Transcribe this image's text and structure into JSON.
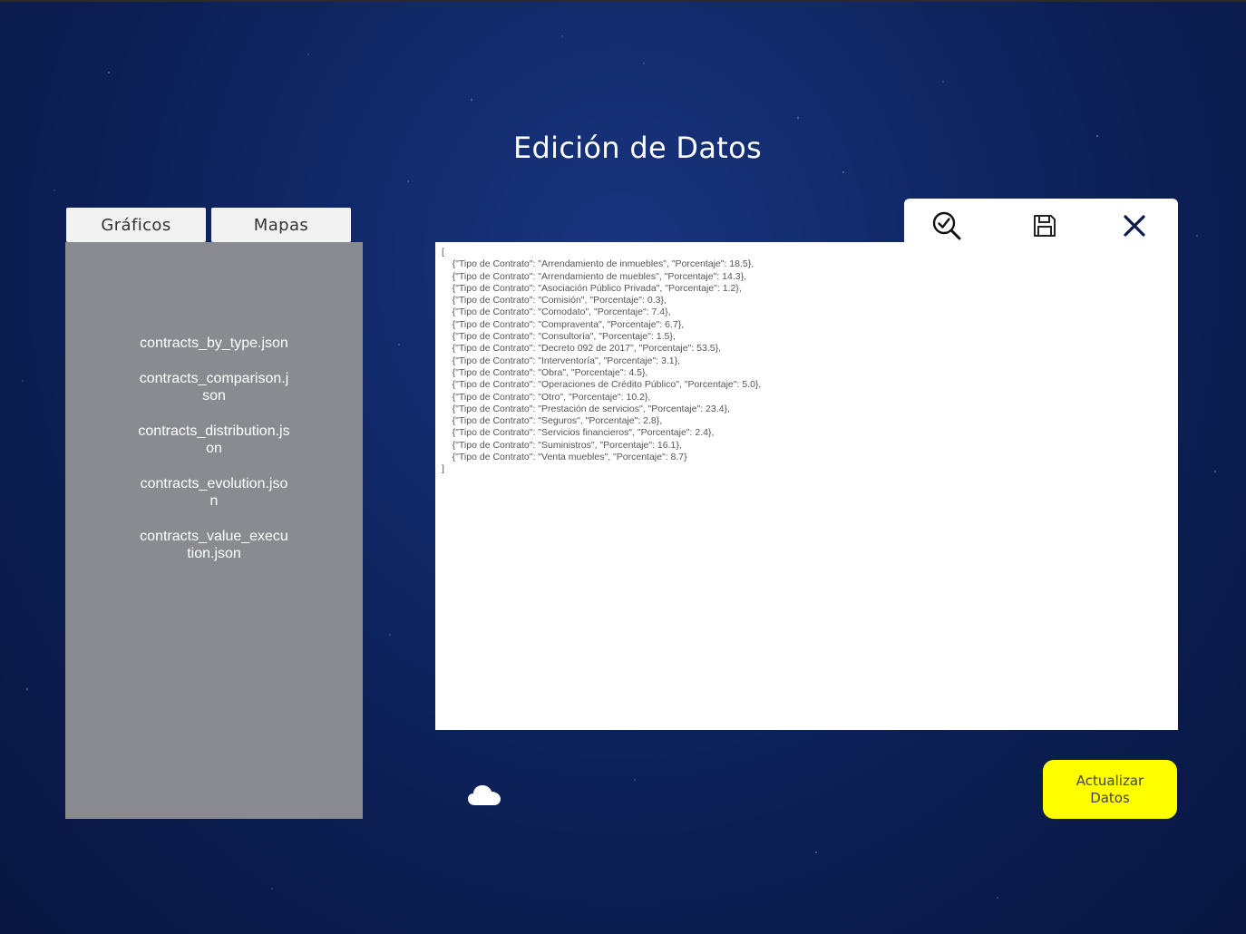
{
  "page": {
    "title": "Edición de Datos"
  },
  "tabs": [
    {
      "label": "Gráficos"
    },
    {
      "label": "Mapas"
    }
  ],
  "files": [
    "contracts_by_type.json",
    "contracts_comparison.json",
    "contracts_distribution.json",
    "contracts_evolution.json",
    "contracts_value_execution.json"
  ],
  "toolbar": {
    "validate_icon": "magnifier-check-icon",
    "save_icon": "floppy-disk-icon",
    "close_icon": "close-icon"
  },
  "editor": {
    "content": "[\n    {\"Tipo de Contrato\": \"Arrendamiento de inmuebles\", \"Porcentaje\": 18.5},\n    {\"Tipo de Contrato\": \"Arrendamiento de muebles\", \"Porcentaje\": 14.3},\n    {\"Tipo de Contrato\": \"Asociación Público Privada\", \"Porcentaje\": 1.2},\n    {\"Tipo de Contrato\": \"Comisión\", \"Porcentaje\": 0.3},\n    {\"Tipo de Contrato\": \"Comodato\", \"Porcentaje\": 7.4},\n    {\"Tipo de Contrato\": \"Compraventa\", \"Porcentaje\": 6.7},\n    {\"Tipo de Contrato\": \"Consultoría\", \"Porcentaje\": 1.5},\n    {\"Tipo de Contrato\": \"Decreto 092 de 2017\", \"Porcentaje\": 53.5},\n    {\"Tipo de Contrato\": \"Interventoría\", \"Porcentaje\": 3.1},\n    {\"Tipo de Contrato\": \"Obra\", \"Porcentaje\": 4.5},\n    {\"Tipo de Contrato\": \"Operaciones de Crédito Público\", \"Porcentaje\": 5.0},\n    {\"Tipo de Contrato\": \"Otro\", \"Porcentaje\": 10.2},\n    {\"Tipo de Contrato\": \"Prestación de servicios\", \"Porcentaje\": 23.4},\n    {\"Tipo de Contrato\": \"Seguros\", \"Porcentaje\": 2.8},\n    {\"Tipo de Contrato\": \"Servicios financieros\", \"Porcentaje\": 2.4},\n    {\"Tipo de Contrato\": \"Suministros\", \"Porcentaje\": 16.1},\n    {\"Tipo de Contrato\": \"Venta muebles\", \"Porcentaje\": 8.7}\n]"
  },
  "upload": {
    "icon": "cloud-icon"
  },
  "actions": {
    "update_label": "Actualizar Datos"
  },
  "colors": {
    "background": "#0f2563",
    "panel": "#8a8b90",
    "update_button": "#ffff00"
  }
}
